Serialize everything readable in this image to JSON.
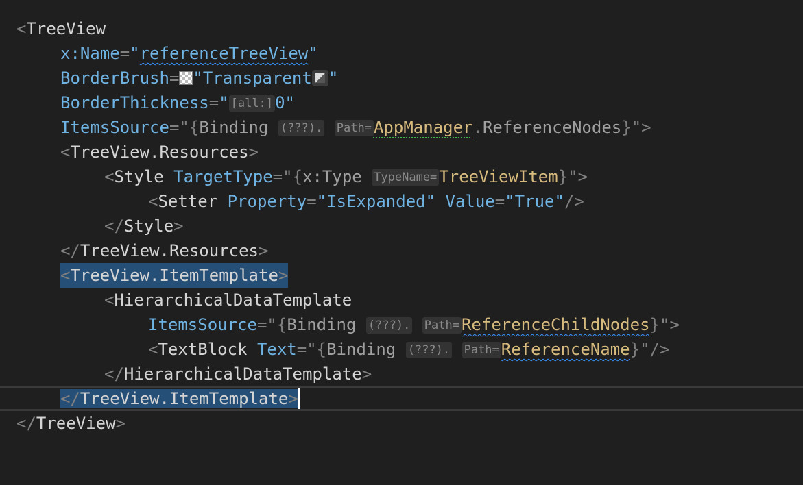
{
  "editor": {
    "lines": {
      "l1": {
        "open": "<",
        "tag": "TreeView"
      },
      "l2": {
        "attr": "x:Name",
        "eq": "=",
        "q1": "\"",
        "value": "referenceTreeView",
        "q2": "\""
      },
      "l3": {
        "attr": "BorderBrush",
        "eq": "=",
        "q1": "\"",
        "value": "Transparent",
        "q2": "\""
      },
      "l4": {
        "attr": "BorderThickness",
        "eq": "=",
        "q1": "\"",
        "hint": "[all:]",
        "value": "0",
        "q2": "\""
      },
      "l5": {
        "attr": "ItemsSource",
        "eq": "=",
        "q1": "\"",
        "brace_open": "{",
        "ext": "Binding",
        "hint1": "(???).",
        "hint2": "Path=",
        "path1": "AppManager",
        "dot": ".",
        "path2": "ReferenceNodes",
        "brace_close": "}",
        "q2": "\"",
        "close": ">"
      },
      "l6": {
        "open": "<",
        "tag": "TreeView.Resources",
        "close": ">"
      },
      "l7": {
        "open": "<",
        "tag": "Style",
        "attr": "TargetType",
        "eq": "=",
        "q1": "\"",
        "brace_open": "{",
        "ext": "x:Type",
        "hint": "TypeName=",
        "type": "TreeViewItem",
        "brace_close": "}",
        "q2": "\"",
        "close": ">"
      },
      "l8": {
        "open": "<",
        "tag": "Setter",
        "attr1": "Property",
        "eq1": "=",
        "val1": "\"IsExpanded\"",
        "attr2": "Value",
        "eq2": "=",
        "val2": "\"True\"",
        "close": "/>"
      },
      "l9": {
        "open": "</",
        "tag": "Style",
        "close": ">"
      },
      "l10": {
        "open": "</",
        "tag": "TreeView.Resources",
        "close": ">"
      },
      "l11": {
        "open": "<",
        "tag": "TreeView.ItemTemplate",
        "close": ">"
      },
      "l12": {
        "open": "<",
        "tag": "HierarchicalDataTemplate"
      },
      "l13": {
        "attr": "ItemsSource",
        "eq": "=",
        "q1": "\"",
        "brace_open": "{",
        "ext": "Binding",
        "hint1": "(???).",
        "hint2": "Path=",
        "path": "ReferenceChildNodes",
        "brace_close": "}",
        "q2": "\"",
        "close": ">"
      },
      "l14": {
        "open": "<",
        "tag": "TextBlock",
        "attr": "Text",
        "eq": "=",
        "q1": "\"",
        "brace_open": "{",
        "ext": "Binding",
        "hint1": "(???).",
        "hint2": "Path=",
        "path": "ReferenceName",
        "brace_close": "}",
        "q2": "\"",
        "close": "/>"
      },
      "l15": {
        "open": "</",
        "tag": "HierarchicalDataTemplate",
        "close": ">"
      },
      "l16": {
        "open": "</",
        "tag": "TreeView.ItemTemplate",
        "close": ">"
      },
      "l17": {
        "open": "</",
        "tag": "TreeView",
        "close": ">"
      }
    },
    "icons": {
      "color_swatch": "checkerboard-swatch-icon",
      "color_picker": "color-picker-icon"
    },
    "colors": {
      "background": "#1f1f1f",
      "selection": "#264f78",
      "attribute": "#6fb3e3",
      "markup_value": "#d7ba7d"
    }
  }
}
